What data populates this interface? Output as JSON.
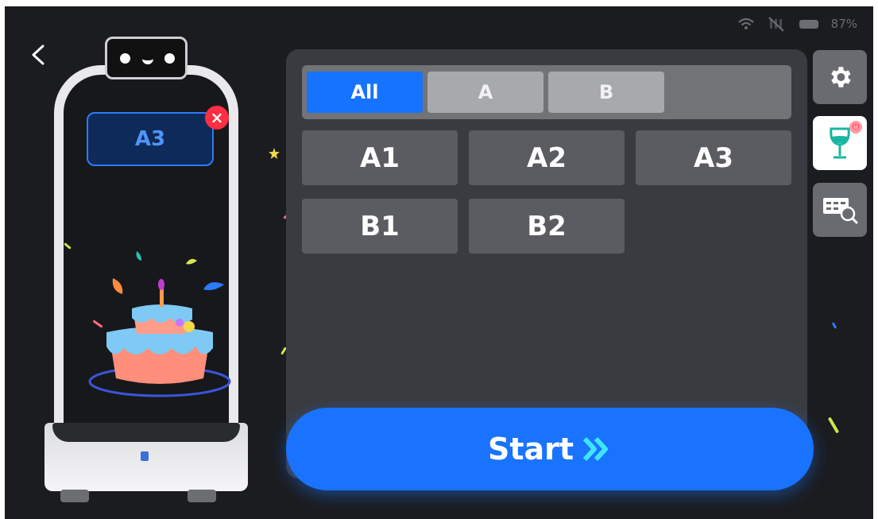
{
  "status": {
    "battery": "87%"
  },
  "robot": {
    "bubble_label": "A3"
  },
  "tabs": [
    {
      "label": "All",
      "active": true
    },
    {
      "label": "A",
      "active": false
    },
    {
      "label": "B",
      "active": false
    }
  ],
  "tables": [
    "A1",
    "A2",
    "A3",
    "B1",
    "B2"
  ],
  "start_label": "Start",
  "colors": {
    "accent": "#1673ff",
    "chevron": "#3fe6f7",
    "panel": "#3a3b40",
    "close": "#ff2e43"
  },
  "icons": [
    "back-icon",
    "wifi-icon",
    "no-signal-icon",
    "battery-icon",
    "gear-icon",
    "wine-glass-icon",
    "power-icon",
    "table-search-icon",
    "close-icon",
    "chevrons-right-icon"
  ]
}
